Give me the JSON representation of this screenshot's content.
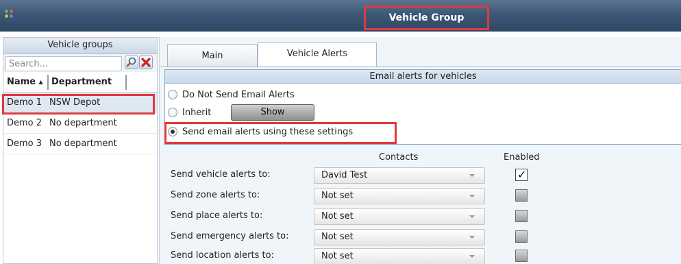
{
  "window": {
    "title": "Vehicle Group",
    "icon": "app-logo-icon"
  },
  "sidebar": {
    "heading": "Vehicle groups",
    "search_placeholder": "Search...",
    "columns": {
      "name": "Name",
      "department": "Department"
    },
    "sort_indicator": "▲",
    "rows": [
      {
        "name": "Demo 1",
        "department": "NSW Depot",
        "selected": true
      },
      {
        "name": "Demo 2",
        "department": "No department",
        "selected": false
      },
      {
        "name": "Demo 3",
        "department": "No department",
        "selected": false
      }
    ]
  },
  "tabs": [
    {
      "label": "Main",
      "active": false
    },
    {
      "label": "Vehicle Alerts",
      "active": true
    }
  ],
  "email_alerts": {
    "heading": "Email alerts for vehicles",
    "options": [
      {
        "label": "Do Not Send Email Alerts",
        "selected": false
      },
      {
        "label": "Inherit",
        "selected": false
      },
      {
        "label": "Send email alerts using these settings",
        "selected": true
      }
    ],
    "show_button": "Show"
  },
  "contacts_table": {
    "contacts_header": "Contacts",
    "enabled_header": "Enabled",
    "rows": [
      {
        "label": "Send vehicle alerts to:",
        "contact": "David Test",
        "enabled": true
      },
      {
        "label": "Send zone alerts to:",
        "contact": "Not set",
        "enabled": false
      },
      {
        "label": "Send place alerts to:",
        "contact": "Not set",
        "enabled": false
      },
      {
        "label": "Send emergency alerts to:",
        "contact": "Not set",
        "enabled": false
      },
      {
        "label": "Send location alerts to:",
        "contact": "Not set",
        "enabled": false
      }
    ]
  },
  "colors": {
    "highlight": "#e0393e",
    "titlebar": "#3d5877",
    "panel": "#f0f5fa"
  }
}
